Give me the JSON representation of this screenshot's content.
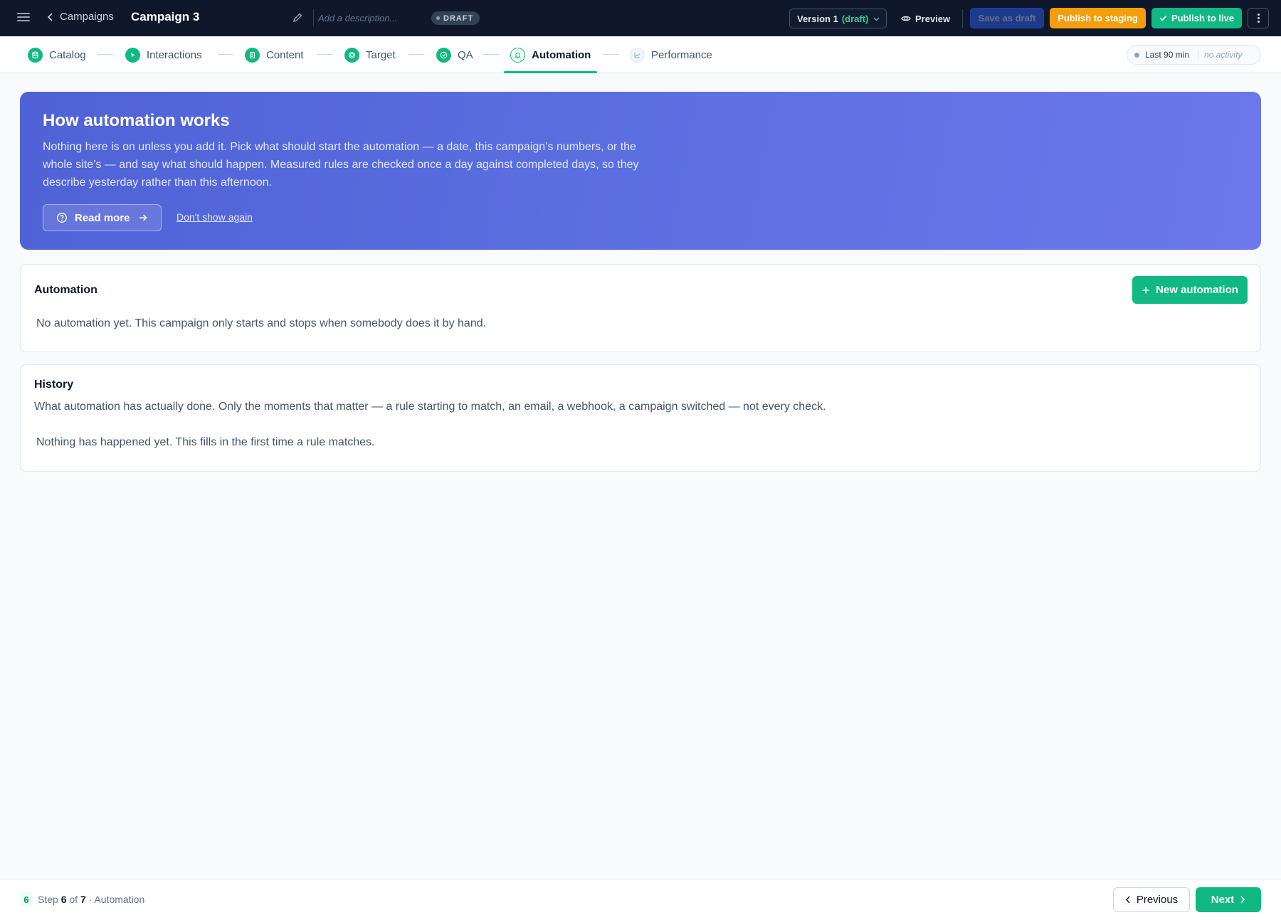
{
  "header": {
    "back_label": "Campaigns",
    "title": "Campaign 3",
    "description_placeholder": "Add a description...",
    "status_badge": "DRAFT",
    "version_label": "Version 1",
    "version_state": "(draft)",
    "preview_label": "Preview",
    "save_draft_label": "Save as draft",
    "publish_staging_label": "Publish to staging",
    "publish_live_label": "Publish to live"
  },
  "steps": [
    {
      "label": "Catalog",
      "icon": "catalog-icon",
      "state": "done"
    },
    {
      "label": "Interactions",
      "icon": "cursor-icon",
      "state": "done"
    },
    {
      "label": "Content",
      "icon": "document-icon",
      "state": "done"
    },
    {
      "label": "Target",
      "icon": "target-icon",
      "state": "done"
    },
    {
      "label": "QA",
      "icon": "check-circle-icon",
      "state": "done"
    },
    {
      "label": "Automation",
      "icon": "bell-icon",
      "state": "active"
    },
    {
      "label": "Performance",
      "icon": "chart-icon",
      "state": "pending"
    }
  ],
  "activity": {
    "window_label": "Last 90 min",
    "status": "no activity"
  },
  "banner": {
    "title": "How automation works",
    "body": "Nothing here is on unless you add it. Pick what should start the automation — a date, this campaign’s numbers, or the whole site’s — and say what should happen. Measured rules are checked once a day against completed days, so they describe yesterday rather than this afternoon.",
    "read_more_label": "Read more",
    "dismiss_label": "Don't show again"
  },
  "automation_card": {
    "title": "Automation",
    "new_button_label": "New automation",
    "empty_text": "No automation yet. This campaign only starts and stops when somebody does it by hand."
  },
  "history_card": {
    "title": "History",
    "subtitle": "What automation has actually done. Only the moments that matter — a rule starting to match, an email, a webhook, a campaign switched — not every check.",
    "empty_text": "Nothing has happened yet. This fills in the first time a rule matches."
  },
  "footer": {
    "step_number": "6",
    "step_word": "Step",
    "current": "6",
    "of_word": "of",
    "total": "7",
    "current_name": "· Automation",
    "previous_label": "Previous",
    "next_label": "Next"
  },
  "colors": {
    "topbar_bg": "#0f172a",
    "accent_green": "#10b981",
    "staging_orange": "#f59e0b",
    "banner_blue": "#5b6ee0"
  }
}
